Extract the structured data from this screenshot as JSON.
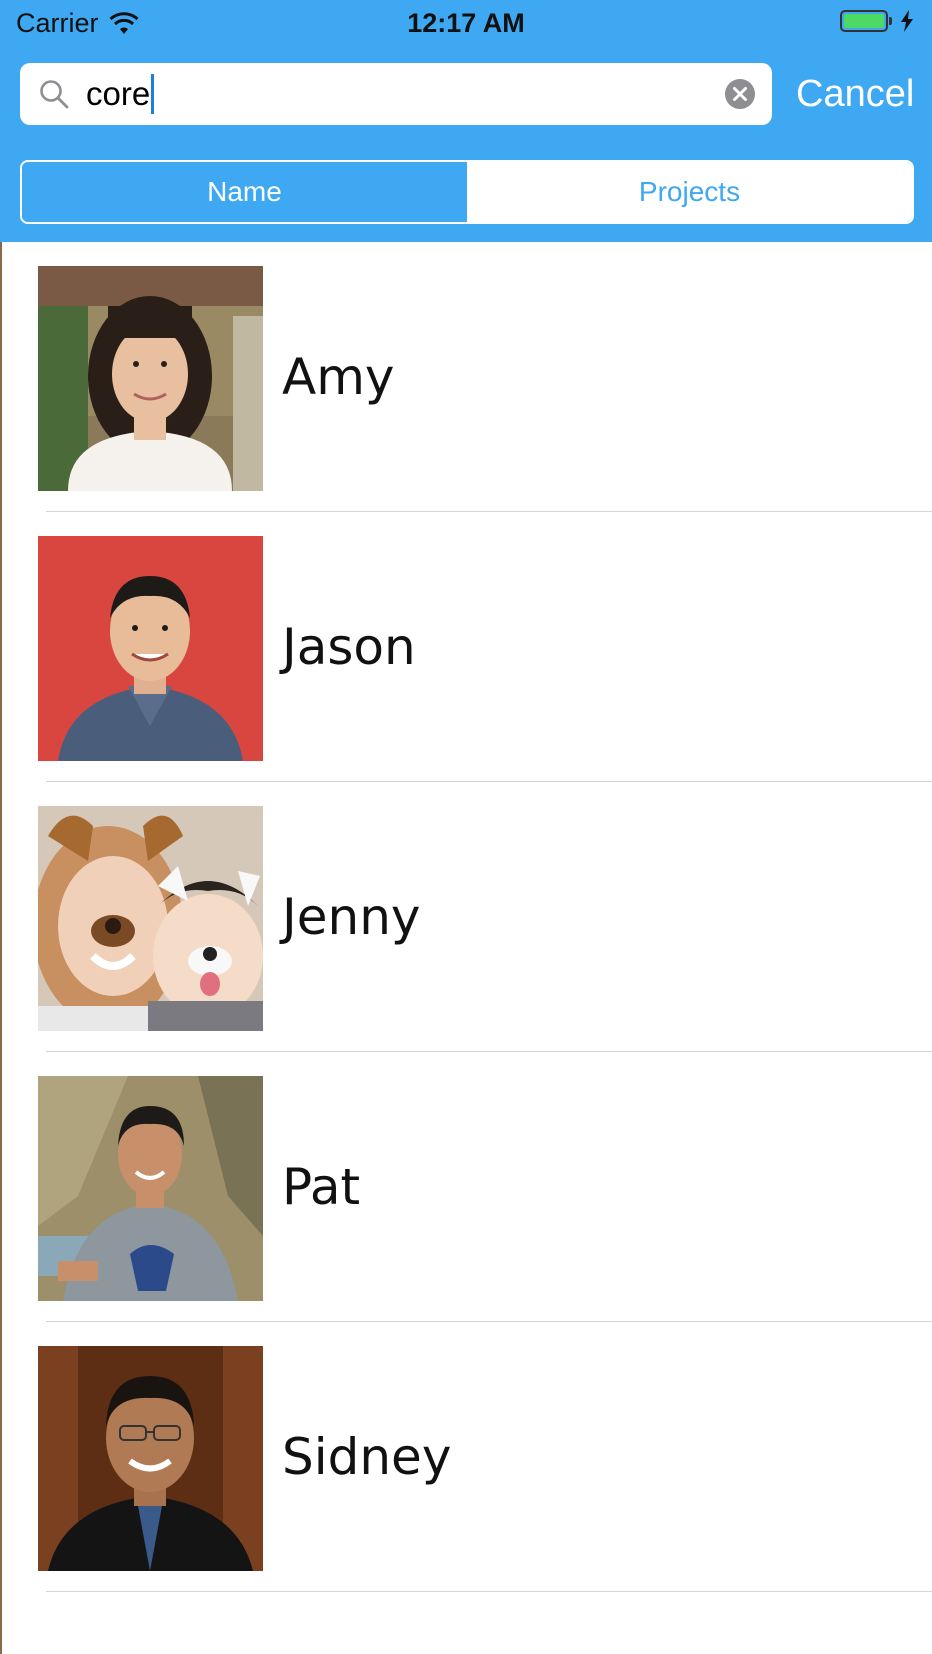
{
  "status_bar": {
    "carrier": "Carrier",
    "time": "12:17 AM",
    "battery_color": "#4cd964"
  },
  "search": {
    "value": "core",
    "cancel_label": "Cancel",
    "icon": "search-icon",
    "clear_icon": "clear-icon"
  },
  "segments": {
    "selected": "Name",
    "items": [
      {
        "label": "Name"
      },
      {
        "label": "Projects"
      }
    ]
  },
  "people": [
    {
      "name": "Amy"
    },
    {
      "name": "Jason"
    },
    {
      "name": "Jenny"
    },
    {
      "name": "Pat"
    },
    {
      "name": "Sidney"
    }
  ],
  "colors": {
    "accent": "#3ea8f2"
  }
}
